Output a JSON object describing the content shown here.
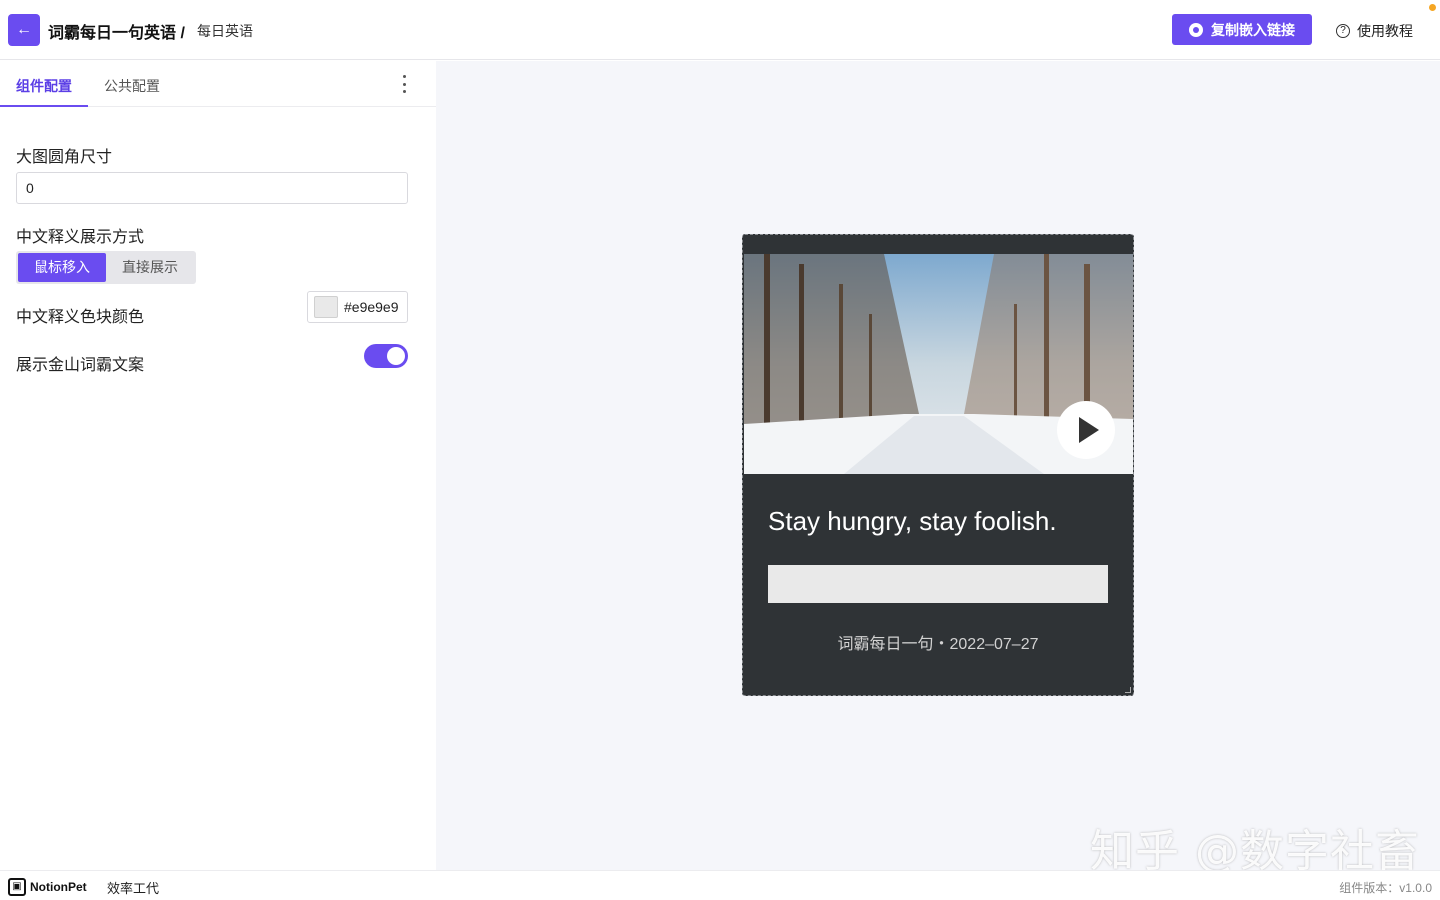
{
  "header": {
    "title": "词霸每日一句英语 /",
    "subtitle": "每日英语",
    "copy_button": "复制嵌入链接",
    "help_link": "使用教程",
    "back_icon": "←",
    "help_icon": "?"
  },
  "tabs": [
    {
      "label": "组件配置",
      "active": true
    },
    {
      "label": "公共配置",
      "active": false
    }
  ],
  "config": {
    "radius_label": "大图圆角尺寸",
    "radius_value": "0",
    "cn_display_label": "中文释义展示方式",
    "cn_display_options": [
      "鼠标移入",
      "直接展示"
    ],
    "cn_display_selected": "鼠标移入",
    "cn_color_label": "中文释义色块颜色",
    "cn_color_value": "#e9e9e9",
    "show_copy_label": "展示金山词霸文案",
    "show_copy_enabled": true
  },
  "preview": {
    "quote": "Stay hungry, stay foolish.",
    "meta": "词霸每日一句・2022–07–27",
    "card_bg": "#2f3336",
    "cn_block_color": "#e9e9e9"
  },
  "watermark": "知乎 @数字社畜",
  "footer": {
    "brand1": "NotionPet",
    "brand2": "效率工代",
    "version": "组件版本：v1.0.0"
  },
  "colors": {
    "accent": "#6a4cf0",
    "notify_dot": "#f5a623"
  }
}
